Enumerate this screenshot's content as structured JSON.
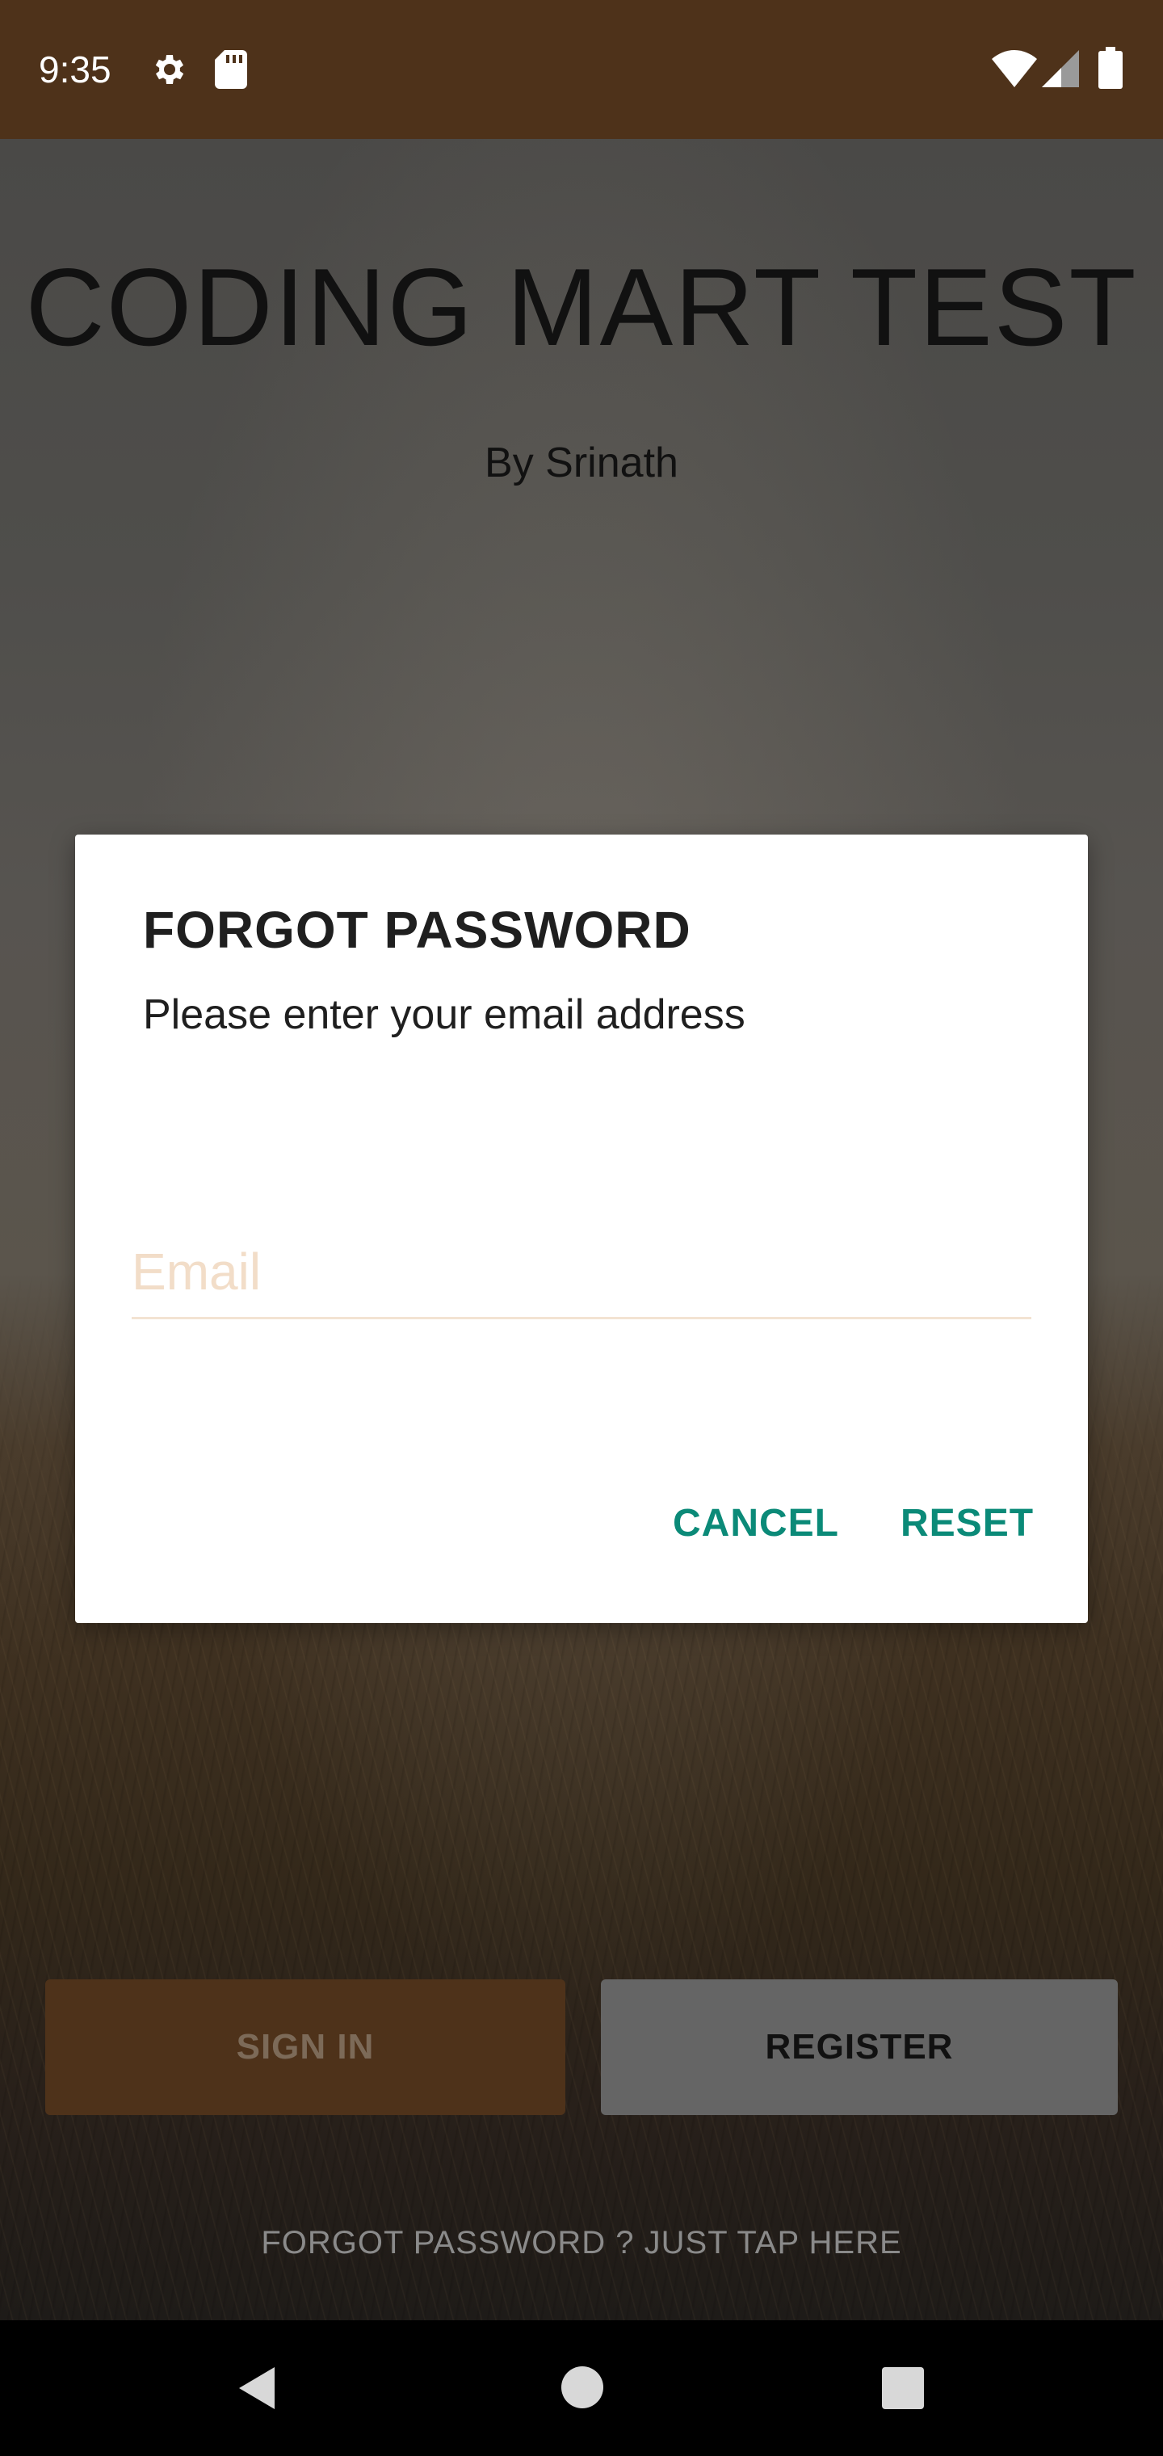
{
  "status_bar": {
    "time": "9:35",
    "icons": [
      "gear-icon",
      "sd-card-icon",
      "wifi-icon",
      "cell-signal-icon",
      "battery-icon"
    ],
    "background_color": "#4e321a"
  },
  "app": {
    "title": "CODING MART TEST",
    "subtitle": "By Srinath",
    "sign_in_label": "SIGN IN",
    "register_label": "REGISTER",
    "forgot_link_label": "FORGOT PASSWORD ? JUST TAP HERE",
    "sign_in_color": "#4e321a",
    "register_color": "#656565"
  },
  "dialog": {
    "title": "FORGOT PASSWORD",
    "message": "Please enter your email address",
    "email_placeholder": "Email",
    "email_value": "",
    "cancel_label": "CANCEL",
    "reset_label": "RESET",
    "accent_color": "#0b8a78"
  },
  "nav_bar": {
    "icons": [
      "back-icon",
      "home-icon",
      "recents-icon"
    ]
  }
}
